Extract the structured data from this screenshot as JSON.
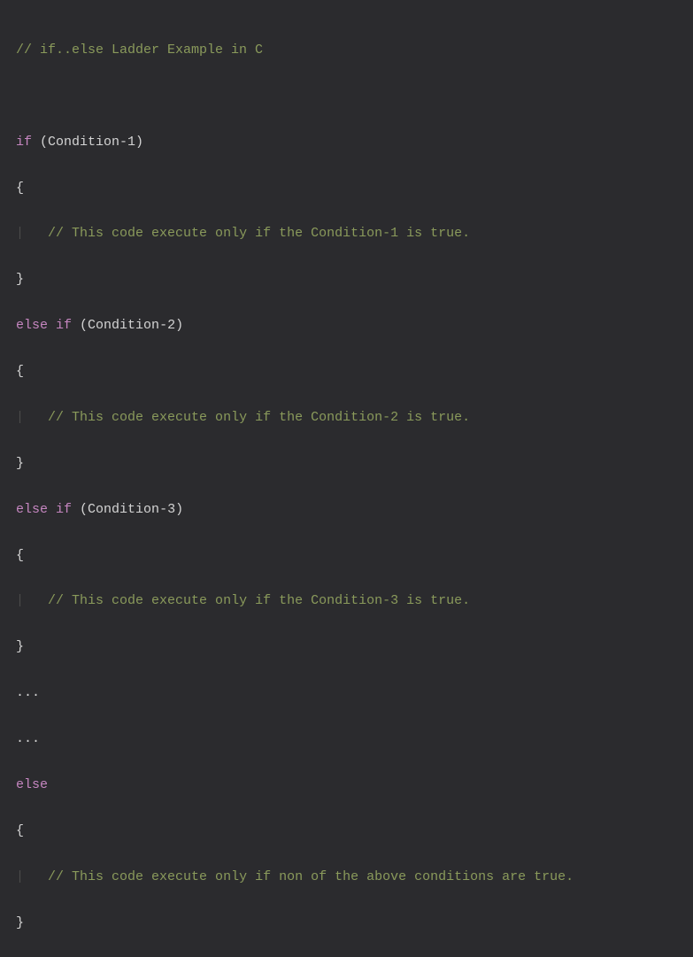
{
  "code": {
    "comment_header": "// if..else Ladder Example in C",
    "if_keyword": "if",
    "else_keyword": "else",
    "cond1": " (Condition-1)",
    "cond2": " (Condition-2)",
    "cond3": " (Condition-3)",
    "open_brace": "{",
    "close_brace": "}",
    "indent_guide": "|",
    "indent_spaces": "   ",
    "comment_body1": "// This code execute only if the Condition-1 is true.",
    "comment_body2": "// This code execute only if the Condition-2 is true.",
    "comment_body3": "// This code execute only if the Condition-3 is true.",
    "comment_body_else": "// This code execute only if non of the above conditions are true.",
    "dots": "...",
    "space": " "
  }
}
